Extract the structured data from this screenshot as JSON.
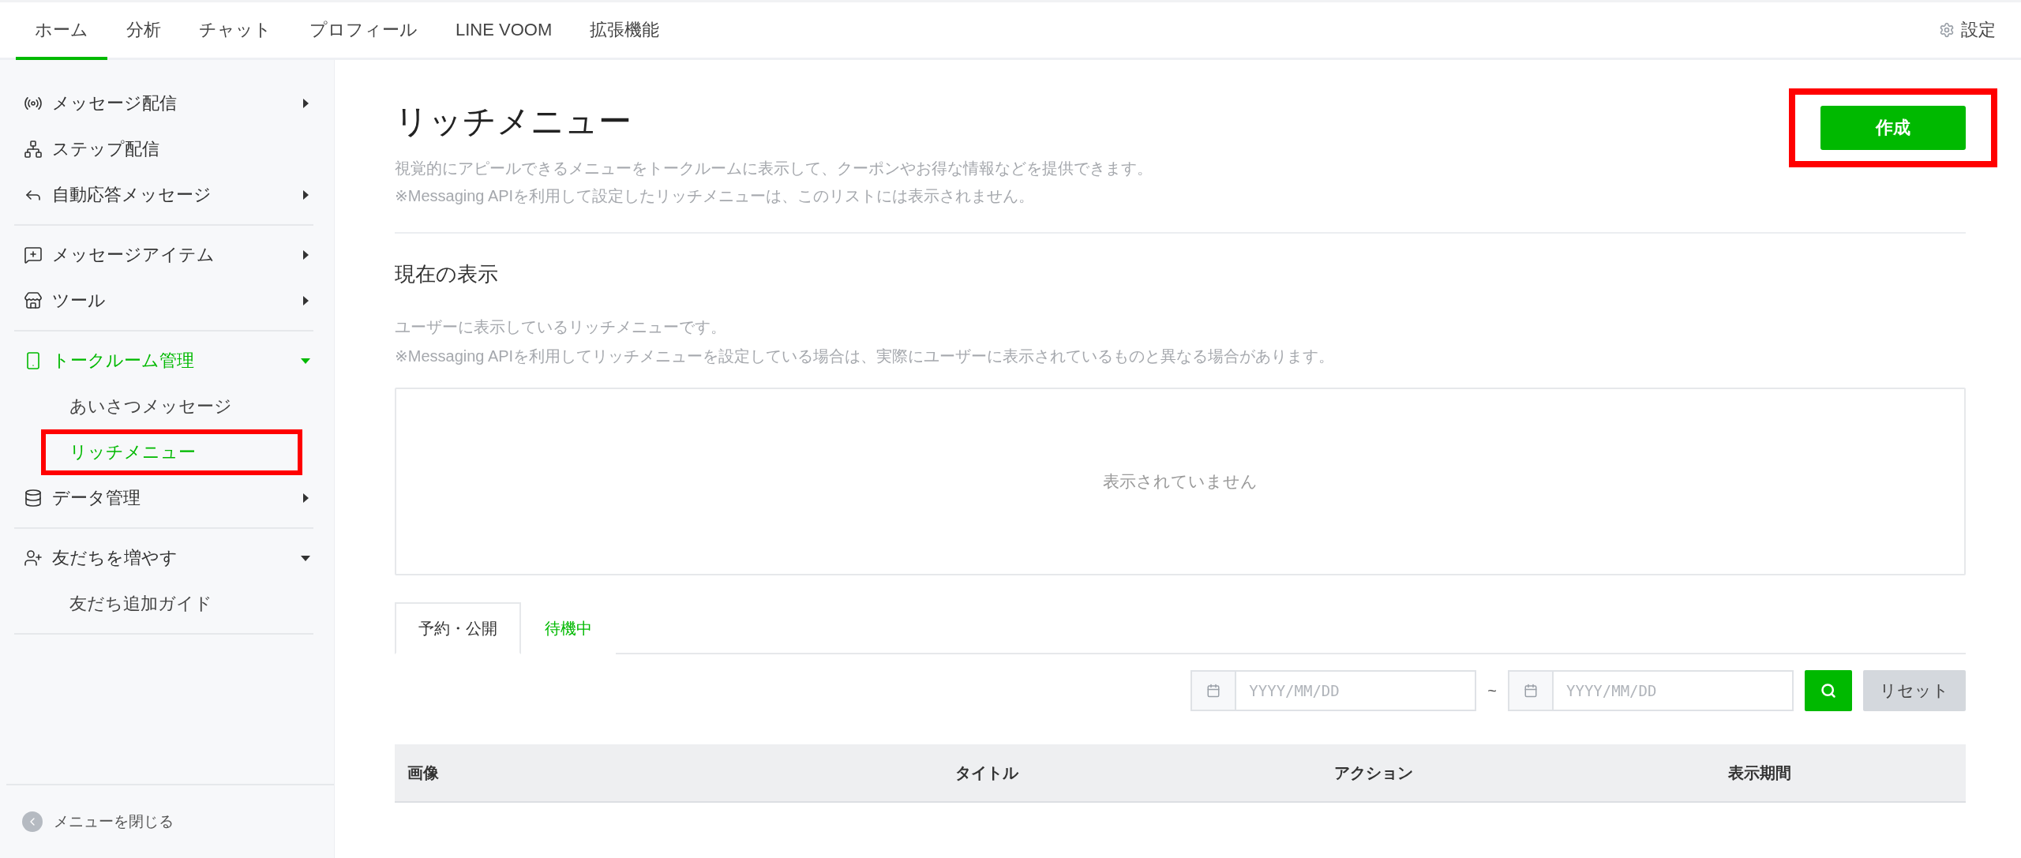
{
  "nav": {
    "tabs": [
      {
        "label": "ホーム",
        "selected": true
      },
      {
        "label": "分析",
        "selected": false
      },
      {
        "label": "チャット",
        "selected": false
      },
      {
        "label": "プロフィール",
        "selected": false
      },
      {
        "label": "LINE VOOM",
        "selected": false
      },
      {
        "label": "拡張機能",
        "selected": false
      }
    ],
    "settings": "設定"
  },
  "sidebar": {
    "groups": [
      {
        "items": [
          {
            "kind": "folder",
            "label": "メッセージ配信",
            "selected": false,
            "expanded": false
          },
          {
            "kind": "link",
            "label": "ステップ配信",
            "selected": false
          },
          {
            "kind": "folder",
            "label": "自動応答メッセージ",
            "selected": false,
            "expanded": false
          }
        ]
      },
      {
        "items": [
          {
            "kind": "folder",
            "label": "メッセージアイテム",
            "selected": false,
            "expanded": false
          },
          {
            "kind": "folder",
            "label": "ツール",
            "selected": false,
            "expanded": false
          }
        ]
      },
      {
        "items": [
          {
            "kind": "folder",
            "label": "トークルーム管理",
            "selected": true,
            "expanded": true,
            "children": [
              {
                "label": "あいさつメッセージ",
                "selected": false,
                "highlighted": false
              },
              {
                "label": "リッチメニュー",
                "selected": true,
                "highlighted": true
              }
            ]
          },
          {
            "kind": "folder",
            "label": "データ管理",
            "selected": false,
            "expanded": false
          }
        ]
      },
      {
        "items": [
          {
            "kind": "folder",
            "label": "友だちを増やす",
            "selected": false,
            "expanded": true,
            "children": [
              {
                "label": "友だち追加ガイド",
                "selected": false,
                "highlighted": false
              }
            ]
          }
        ]
      }
    ],
    "close": "メニューを閉じる"
  },
  "main": {
    "title": "リッチメニュー",
    "description": [
      "視覚的にアピールできるメニューをトークルームに表示して、クーポンやお得な情報などを提供できます。",
      "※Messaging APIを利用して設定したリッチメニューは、このリストには表示されません。"
    ],
    "create_button": {
      "label": "作成",
      "highlighted": true
    },
    "current": {
      "heading": "現在の表示",
      "notes": [
        "ユーザーに表示しているリッチメニューです。",
        "※Messaging APIを利用してリッチメニューを設定している場合は、実際にユーザーに表示されているものと異なる場合があります。"
      ],
      "empty_text": "表示されていません"
    },
    "tabs": [
      {
        "label": "予約・公開",
        "selected": true
      },
      {
        "label": "待機中",
        "selected": false
      }
    ],
    "filter": {
      "from_placeholder": "YYYY/MM/DD",
      "separator": "~",
      "to_placeholder": "YYYY/MM/DD",
      "reset": "リセット"
    },
    "table": {
      "columns": [
        "画像",
        "タイトル",
        "アクション",
        "表示期間"
      ]
    }
  }
}
